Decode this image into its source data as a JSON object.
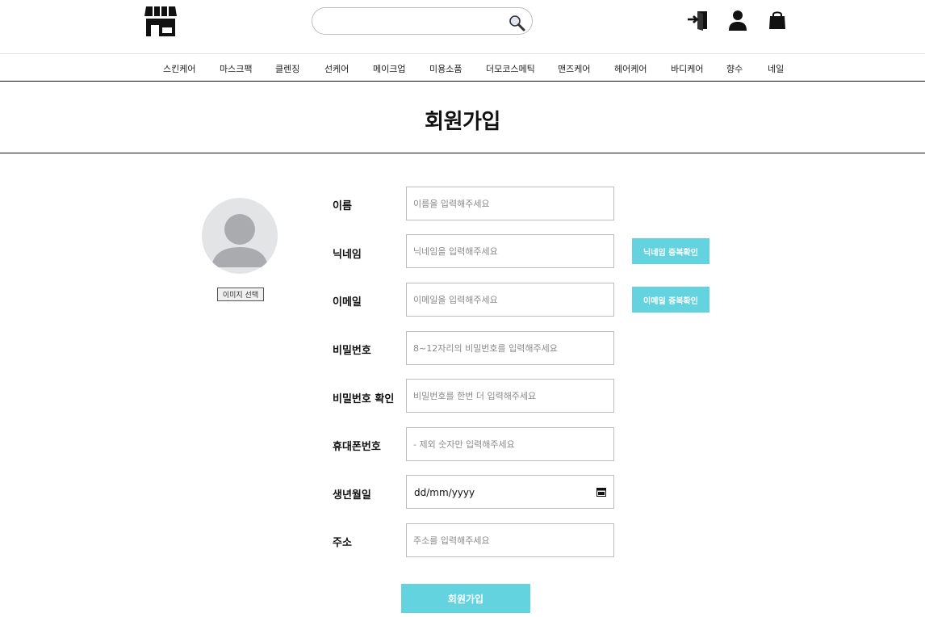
{
  "header": {
    "logo_icon": "store-icon",
    "search": {
      "placeholder": "",
      "value": "",
      "icon": "search-icon"
    },
    "icons": [
      "login-icon",
      "user-icon",
      "shopping-bag-icon"
    ]
  },
  "nav": {
    "items": [
      {
        "label": "스킨케어"
      },
      {
        "label": "마스크팩"
      },
      {
        "label": "클렌징"
      },
      {
        "label": "선케어"
      },
      {
        "label": "메이크업"
      },
      {
        "label": "미용소품"
      },
      {
        "label": "더모코스메틱"
      },
      {
        "label": "맨즈케어"
      },
      {
        "label": "헤어케어"
      },
      {
        "label": "바디케어"
      },
      {
        "label": "향수"
      },
      {
        "label": "네일"
      }
    ]
  },
  "page": {
    "title": "회원가입"
  },
  "profile": {
    "avatar_icon": "user-avatar-icon",
    "image_button": "이미지 선택"
  },
  "form": {
    "name": {
      "label": "이름",
      "placeholder": "이름을 입력해주세요"
    },
    "nickname": {
      "label": "닉네임",
      "placeholder": "닉네임을 입력해주세요",
      "check_button": "닉네임 중복확인"
    },
    "email": {
      "label": "이메일",
      "placeholder": "이메일을 입력해주세요",
      "check_button": "이메일 중복확인"
    },
    "password": {
      "label": "비밀번호",
      "placeholder": "8~12자리의 비밀번호를 입력해주세요"
    },
    "password_confirm": {
      "label": "비밀번호 확인",
      "placeholder": "비밀번호를 한번 더 입력해주세요"
    },
    "phone": {
      "label": "휴대폰번호",
      "placeholder": "- 제외 숫자만 입력해주세요"
    },
    "birth": {
      "label": "생년월일",
      "value": "dd/mm/yyyy",
      "icon": "calendar-icon"
    },
    "address": {
      "label": "주소",
      "placeholder": "주소를 입력해주세요"
    },
    "submit": "회원가입"
  },
  "colors": {
    "accent": "#63d3df",
    "avatar_bg": "#e3e4e6",
    "avatar_fg": "#a9abae",
    "border": "#bdbdbd"
  }
}
